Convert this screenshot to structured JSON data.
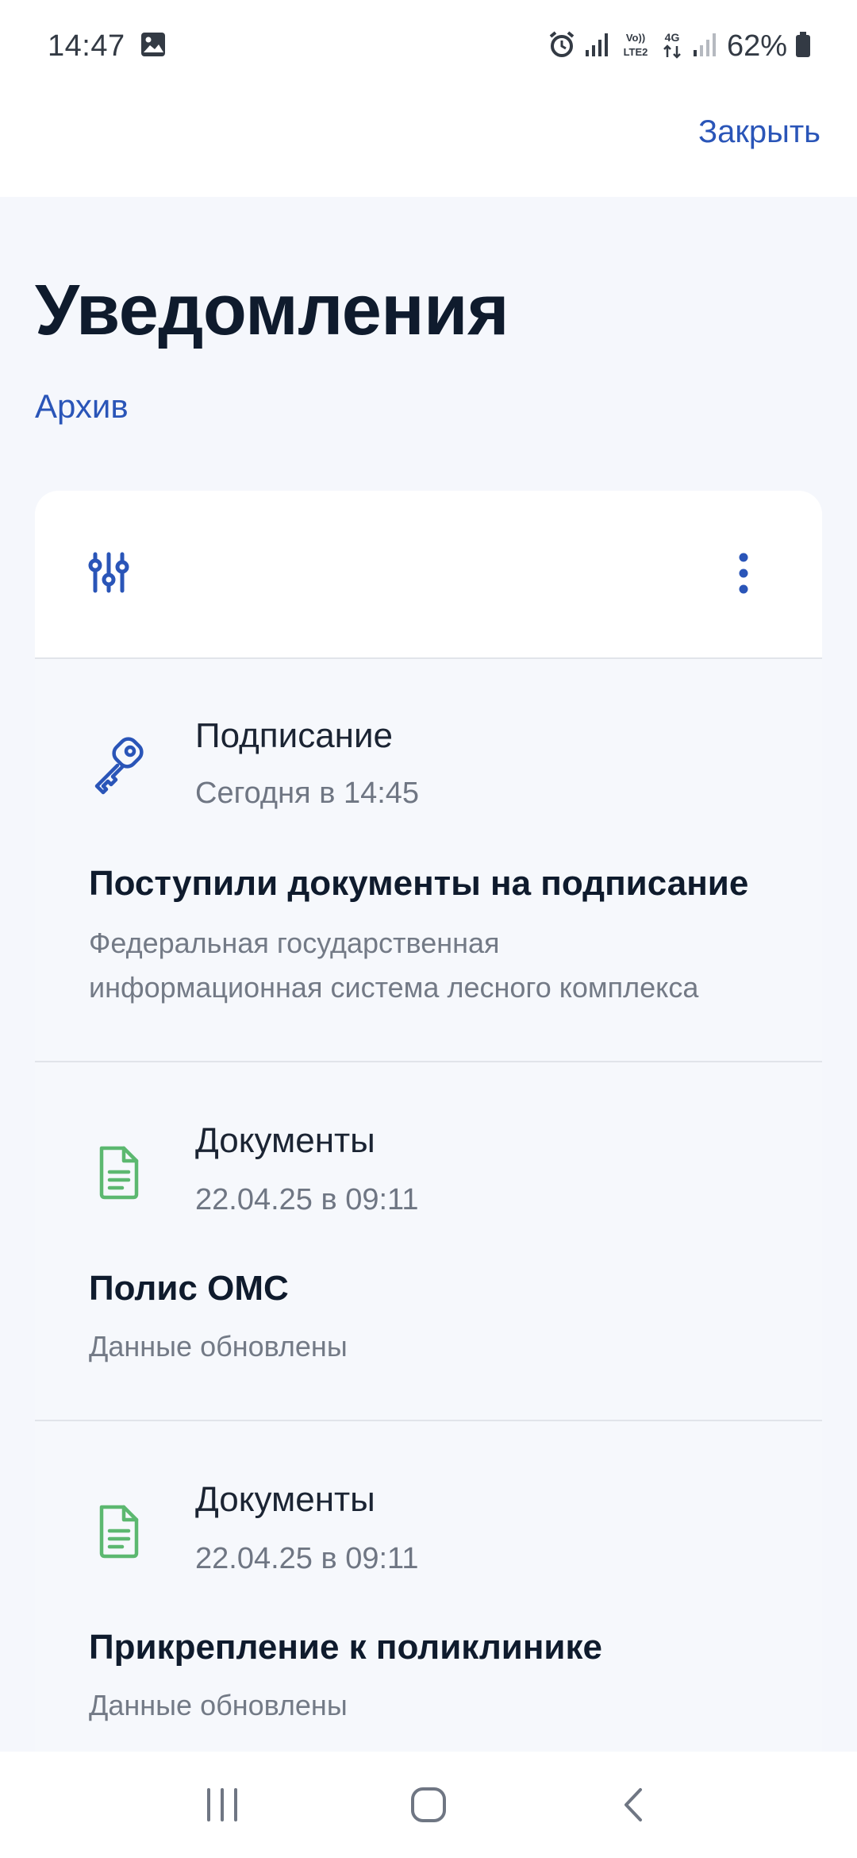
{
  "status_bar": {
    "time": "14:47",
    "battery": "62%",
    "icons": [
      "gallery-icon",
      "alarm-icon",
      "signal-icon",
      "volte-icon",
      "4g-icon",
      "signal-icon",
      "battery-icon"
    ],
    "volte_label": "VoLTE2",
    "net_label": "4G"
  },
  "header": {
    "close_label": "Закрыть"
  },
  "main": {
    "title": "Уведомления",
    "archive_label": "Архив"
  },
  "toolbar": {
    "filter_icon": "sliders-icon",
    "more_icon": "more-vertical-icon"
  },
  "notifications": [
    {
      "icon": "key-icon",
      "category": "Подписание",
      "time": "Сегодня в 14:45",
      "title": "Поступили документы на подписание",
      "body_line1": "Федеральная государственная",
      "body_line2": "информационная система лесного комплекса"
    },
    {
      "icon": "document-icon",
      "category": "Документы",
      "time": "22.04.25 в 09:11",
      "title": "Полис ОМС",
      "body_line1": "Данные обновлены"
    },
    {
      "icon": "document-icon",
      "category": "Документы",
      "time": "22.04.25 в 09:11",
      "title": "Прикрепление к поликлинике",
      "body_line1": "Данные обновлены"
    }
  ],
  "colors": {
    "accent": "#2a55b8",
    "title": "#0f1b2d",
    "doc_icon": "#5cb870",
    "background": "#f5f7fc"
  },
  "nav": {
    "recent": "recent-apps-icon",
    "home": "home-icon",
    "back": "back-icon"
  }
}
